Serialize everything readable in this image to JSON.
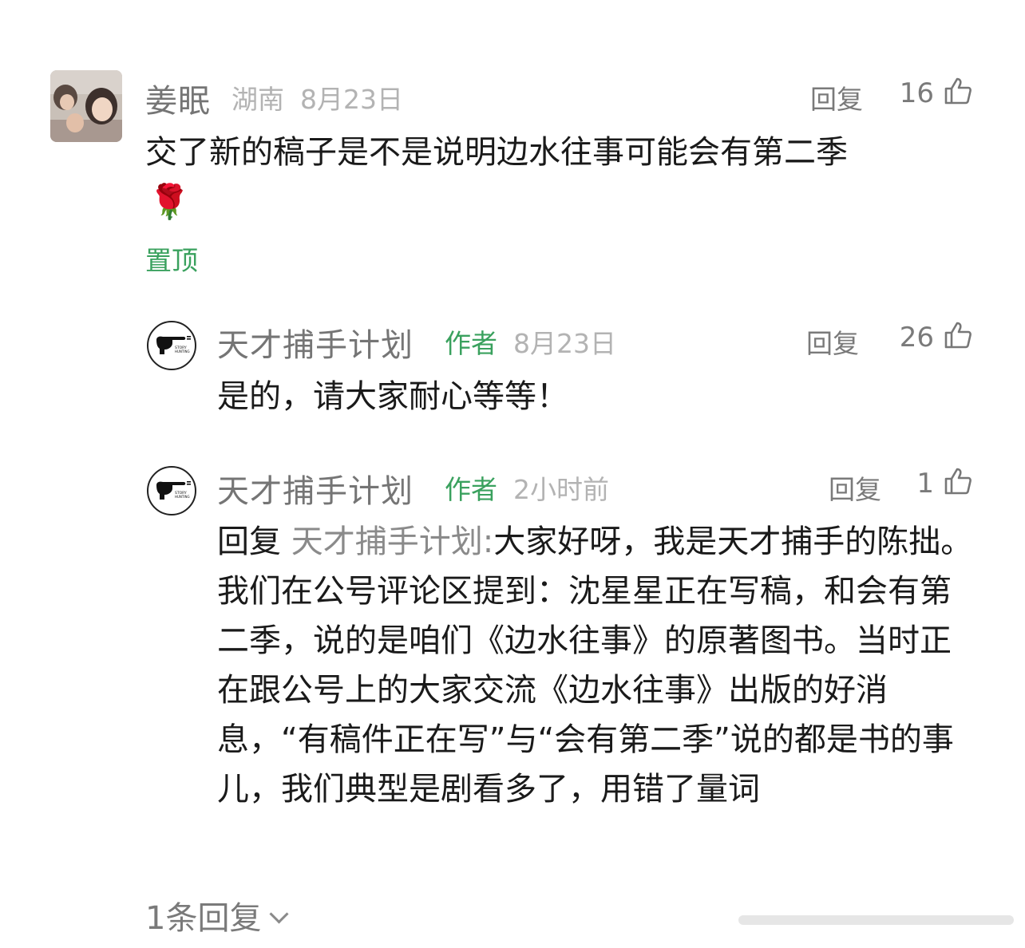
{
  "comment": {
    "username": "姜眠",
    "location": "湖南",
    "date": "8月23日",
    "reply_label": "回复",
    "likes": "16",
    "text": "交了新的稿子是不是说明边水往事可能会有第二季",
    "emoji": "🌹",
    "pinned_label": "置顶"
  },
  "replies": [
    {
      "username": "天才捕手计划",
      "badge": "作者",
      "date": "8月23日",
      "reply_label": "回复",
      "likes": "26",
      "text": "是的，请大家耐心等等！"
    },
    {
      "username": "天才捕手计划",
      "badge": "作者",
      "date": "2小时前",
      "reply_label": "回复",
      "likes": "1",
      "reply_prefix": "回复",
      "reply_target": "天才捕手计划:",
      "text": "大家好呀，我是天才捕手的陈拙。我们在公号评论区提到：沈星星正在写稿，和会有第二季，说的是咱们《边水往事》的原著图书。当时正在跟公号上的大家交流《边水往事》出版的好消息，“有稿件正在写”与“会有第二季”说的都是书的事儿，我们典型是剧看多了，用错了量词"
    }
  ],
  "footer": {
    "more_replies": "1条回复"
  },
  "colors": {
    "author_green": "#3aa15e",
    "meta_gray": "#b3b3b3",
    "name_gray": "#757575"
  }
}
